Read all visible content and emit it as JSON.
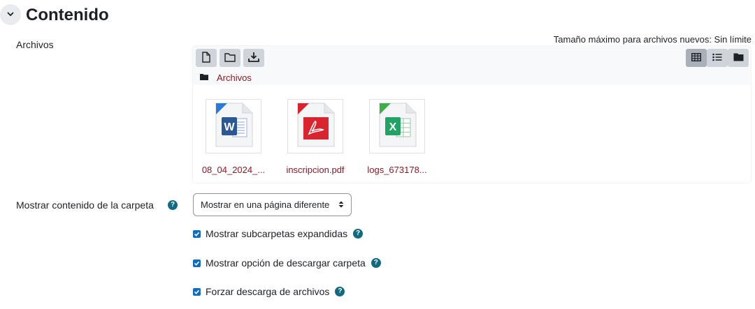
{
  "section": {
    "title": "Contenido",
    "toggle_icon": "chevron-down-icon"
  },
  "files_field": {
    "label": "Archivos",
    "max_size_text": "Tamaño máximo para archivos nuevos: Sin límite",
    "toolbar": {
      "left_icons": [
        "add-file-icon",
        "create-folder-icon",
        "download-icon"
      ],
      "view_icons": [
        "grid-view-icon",
        "list-view-icon",
        "tree-view-icon"
      ],
      "active_view": "grid-view-icon"
    },
    "path": {
      "icon": "folder-icon",
      "label": "Archivos"
    },
    "files": [
      {
        "name": "08_04_2024_...",
        "type": "word",
        "icon": "word-file-icon",
        "color": "#2b5797"
      },
      {
        "name": "inscripcion.pdf",
        "type": "pdf",
        "icon": "pdf-file-icon",
        "color": "#d9232e"
      },
      {
        "name": "logs_673178...",
        "type": "excel",
        "icon": "excel-file-icon",
        "color": "#21a366"
      }
    ]
  },
  "display_field": {
    "label": "Mostrar contenido de la carpeta",
    "help_icon": "help-icon",
    "select_value": "Mostrar en una página diferente"
  },
  "options": [
    {
      "label": "Mostrar subcarpetas expandidas",
      "checked": true
    },
    {
      "label": "Mostrar opción de descargar carpeta",
      "checked": true
    },
    {
      "label": "Forzar descarga de archivos",
      "checked": true
    }
  ],
  "colors": {
    "link": "#8a1a26",
    "checkbox": "#0f6cbf",
    "help": "#116a7f"
  }
}
